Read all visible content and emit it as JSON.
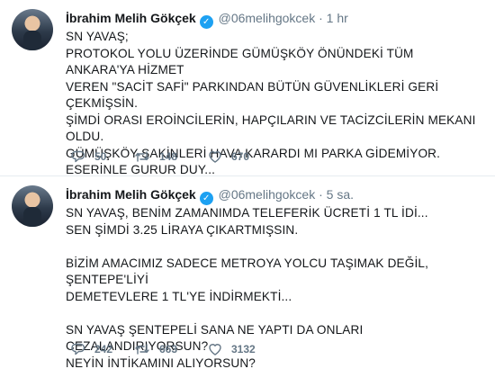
{
  "tweets": [
    {
      "name": "İbrahim Melih Gökçek",
      "handle": "@06melihgokcek",
      "dot": "·",
      "time": "1 hr",
      "lines": [
        "SN YAVAŞ;",
        "PROTOKOL YOLU ÜZERİNDE GÜMÜŞKÖY ÖNÜNDEKİ TÜM ANKARA'YA HİZMET",
        "VEREN \"SACİT SAFİ\" PARKINDAN BÜTÜN GÜVENLİKLERİ GERİ ÇEKMİŞSİN.",
        "ŞİMDİ ORASI EROİNCİLERİN, HAPÇILARIN VE TACİZCİLERİN MEKANI OLDU.",
        "GÜMÜŞKÖY SAKİNLERİ HAVA KARARDI MI PARKA GİDEMİYOR.",
        "ESERİNLE GURUR DUY..."
      ],
      "replies": "50",
      "retweets": "148",
      "likes": "670"
    },
    {
      "name": "İbrahim Melih Gökçek",
      "handle": "@06melihgokcek",
      "dot": "·",
      "time": "5 sa.",
      "lines": [
        "SN YAVAŞ, BENİM ZAMANIMDA TELEFERİK ÜCRETİ 1 TL İDİ...",
        "SEN ŞİMDİ 3.25 LİRAYA ÇIKARTMIŞSIN.",
        "",
        "BİZİM AMACIMIZ SADECE METROYA YOLCU TAŞIMAK DEĞİL, ŞENTEPE'LİYİ",
        "DEMETEVLERE 1 TL'YE İNDİRMEKTİ...",
        "",
        "SN YAVAŞ ŞENTEPELİ SANA NE YAPTI DA ONLARI CEZALANDIRIYORSUN?",
        "NEYİN İNTİKAMINI ALIYORSUN?"
      ],
      "replies": "242",
      "retweets": "663",
      "likes": "3132"
    }
  ],
  "icons": {
    "verified": "verified-check-icon",
    "reply": "reply-bubble-icon",
    "retweet": "retweet-arrows-icon",
    "like": "heart-icon",
    "more": "chevron-down-icon"
  },
  "colors": {
    "text": "#14171a",
    "muted": "#657786",
    "verified": "#1da1f2",
    "divider": "#e6ecf0"
  }
}
